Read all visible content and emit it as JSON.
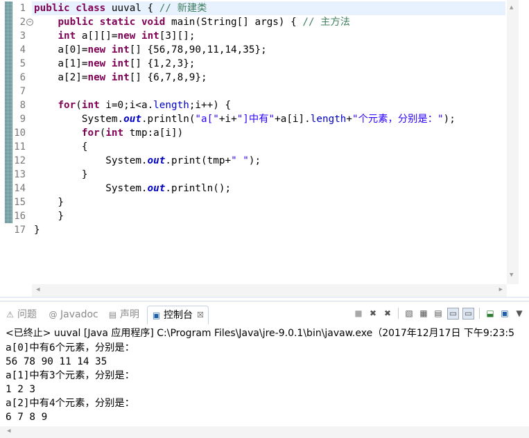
{
  "editor": {
    "line_numbers": [
      "1",
      "2",
      "3",
      "4",
      "5",
      "6",
      "7",
      "8",
      "9",
      "10",
      "11",
      "12",
      "13",
      "14",
      "15",
      "16",
      "17"
    ],
    "code": {
      "l1_kw": "public class",
      "l1_name": " uuval { ",
      "l1_comment": "// 新建类",
      "l2_indent": "    ",
      "l2_kw": "public static void",
      "l2_name": " main(String[] args) { ",
      "l2_comment": "// 主方法",
      "l3_indent": "    ",
      "l3_kw1": "int",
      "l3_mid": " a[][]=",
      "l3_kw2": "new int",
      "l3_rest": "[3][];",
      "l4_pre": "    a[0]=",
      "l4_kw": "new int",
      "l4_rest": "[] {56,78,90,11,14,35};",
      "l5_pre": "    a[1]=",
      "l5_kw": "new int",
      "l5_rest": "[] {1,2,3};",
      "l6_pre": "    a[2]=",
      "l6_kw": "new int",
      "l6_rest": "[] {6,7,8,9};",
      "l8_indent": "    ",
      "l8_kw1": "for",
      "l8_p": "(",
      "l8_kw2": "int",
      "l8_mid": " i=0;i<a.",
      "l8_field": "length",
      "l8_rest": ";i++) {",
      "l9_pre": "        System.",
      "l9_out": "out",
      "l9_mid": ".println(",
      "l9_s1": "\"a[\"",
      "l9_p1": "+i+",
      "l9_s2": "\"]中有\"",
      "l9_p2": "+a[i].",
      "l9_field": "length",
      "l9_p3": "+",
      "l9_s3": "\"个元素，分别是：\"",
      "l9_end": ");",
      "l10_indent": "        ",
      "l10_kw1": "for",
      "l10_p": "(",
      "l10_kw2": "int",
      "l10_rest": " tmp:a[i])",
      "l11": "        {",
      "l12_pre": "            System.",
      "l12_out": "out",
      "l12_mid": ".print(tmp+",
      "l12_s": "\" \"",
      "l12_end": ");",
      "l13": "        }",
      "l14_pre": "            System.",
      "l14_out": "out",
      "l14_end": ".println();",
      "l15": "    }",
      "l16": "    }",
      "l17": "}"
    }
  },
  "view": {
    "tabs": [
      {
        "label": "问题",
        "icon": "problems-icon"
      },
      {
        "label": "Javadoc",
        "icon": "javadoc-icon"
      },
      {
        "label": "声明",
        "icon": "declaration-icon"
      },
      {
        "label": "控制台",
        "icon": "console-icon",
        "close": "☒"
      }
    ],
    "console": {
      "description": "<已终止> uuval [Java 应用程序] C:\\Program Files\\Java\\jre-9.0.1\\bin\\javaw.exe（2017年12月17日 下午9:23:5",
      "output": [
        "a[0]中有6个元素，分别是：",
        "56 78 90 11 14 35",
        "a[1]中有3个元素，分别是：",
        "1 2 3",
        "a[2]中有4个元素，分别是：",
        "6 7 8 9"
      ]
    }
  }
}
